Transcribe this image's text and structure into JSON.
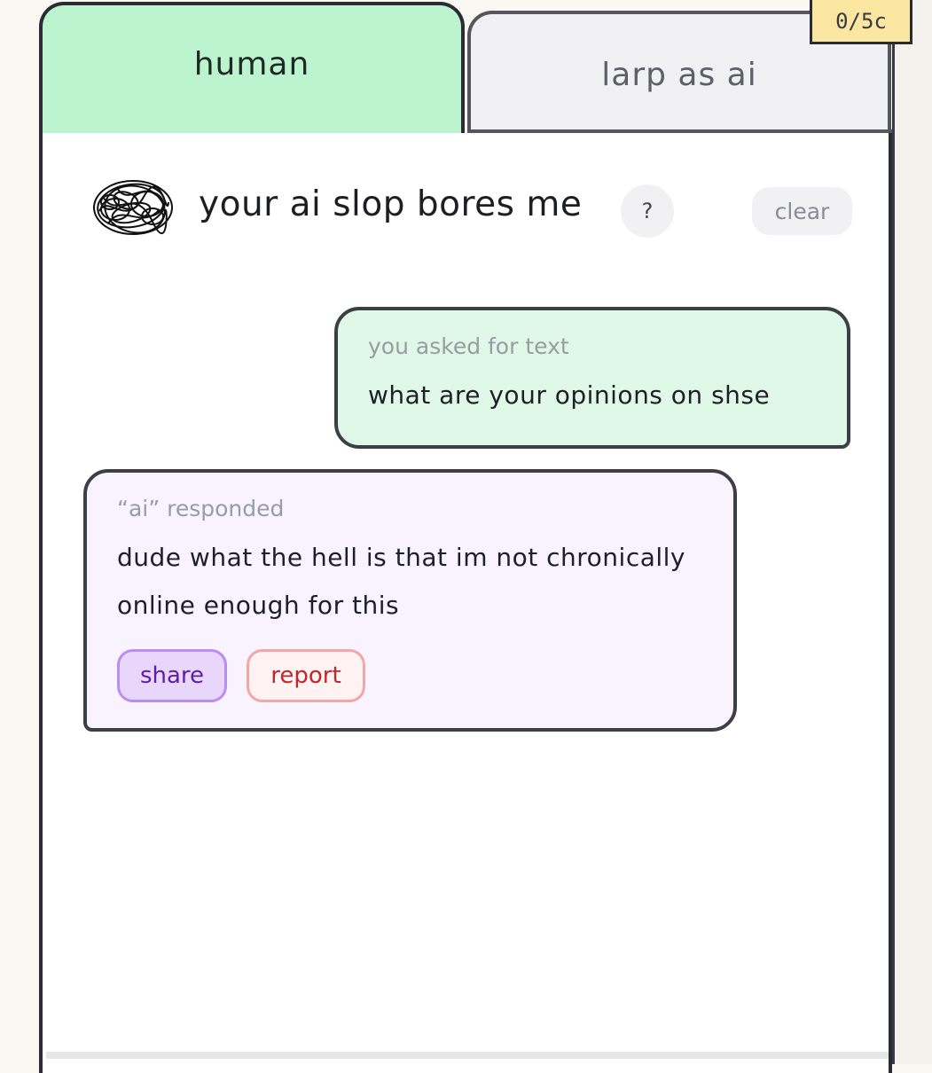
{
  "tabs": {
    "human": "human",
    "larp_ai": "larp as ai"
  },
  "counter": "0/5c",
  "header": {
    "title": "your ai slop bores me",
    "help": "?",
    "clear": "clear"
  },
  "messages": {
    "user": {
      "label": "you asked for text",
      "text": "what are your opinions on shse"
    },
    "ai": {
      "label": "“ai” responded",
      "text": "dude what the hell is that im not chronically online enough for this",
      "share": "share",
      "report": "report"
    }
  },
  "icons": {
    "avatar": "scribble-avatar-icon"
  },
  "colors": {
    "human_tab": "#bbf4cf",
    "ai_tab": "#f1f1f3",
    "counter_badge": "#fbe7a1",
    "user_bubble": "#dff8e7",
    "ai_bubble": "#f8f3fe",
    "share_text": "#5e1fa3",
    "report_text": "#c0262a"
  }
}
